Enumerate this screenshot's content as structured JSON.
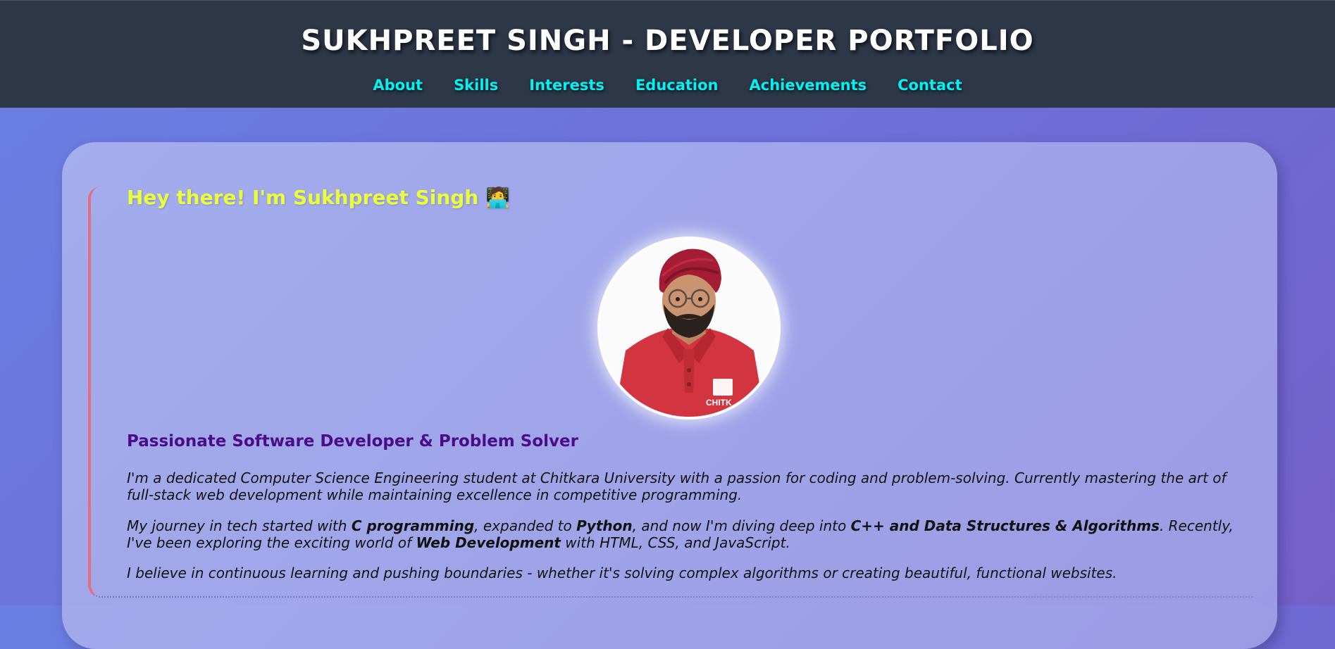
{
  "header": {
    "title": "SUKHPREET SINGH - DEVELOPER PORTFOLIO",
    "nav": [
      "About",
      "Skills",
      "Interests",
      "Education",
      "Achievements",
      "Contact"
    ]
  },
  "about": {
    "greeting": "Hey there! I'm Sukhpreet Singh 🧑‍💻",
    "tagline": "Passionate Software Developer & Problem Solver",
    "p1": "I'm a dedicated Computer Science Engineering student at Chitkara University with a passion for coding and problem-solving. Currently mastering the art of full-stack web development while maintaining excellence in competitive programming.",
    "p2": {
      "t1": "My journey in tech started with ",
      "b1": "C programming",
      "t2": ", expanded to ",
      "b2": "Python",
      "t3": ", and now I'm diving deep into ",
      "b3": "C++ and Data Structures & Algorithms",
      "t4": ". Recently, I've been exploring the exciting world of ",
      "b4": "Web Development",
      "t5": " with HTML, CSS, and JavaScript."
    },
    "p3": "I believe in continuous learning and pushing boundaries - whether it's solving complex algorithms or creating beautiful, functional websites.",
    "shirt_text": "CHITK"
  },
  "colors": {
    "header_bg": "#2d3748",
    "nav_link": "#00f2f2",
    "greeting": "#eaff3a",
    "tagline": "#4b0b8a",
    "accent_border": "#e86a84"
  }
}
